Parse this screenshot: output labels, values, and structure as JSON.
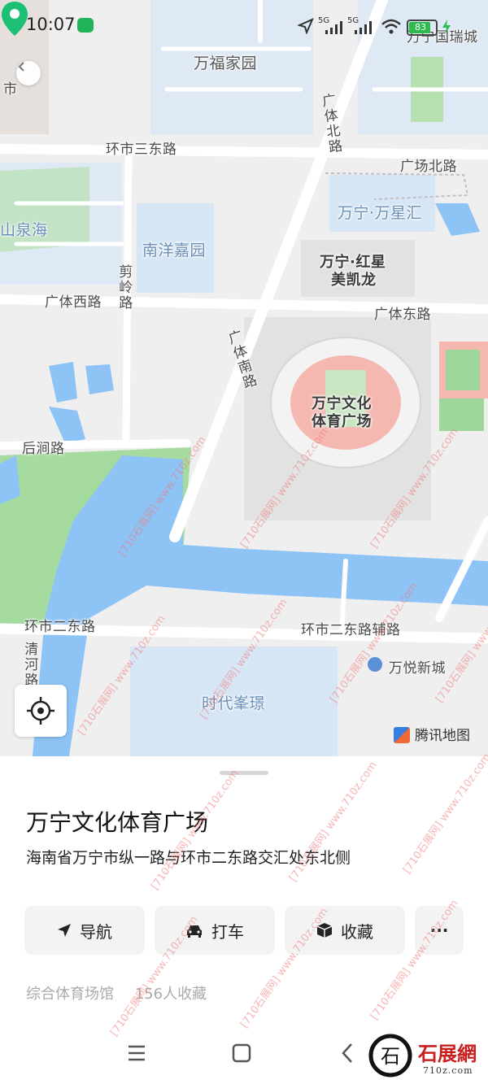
{
  "status_bar": {
    "time": "10:07",
    "network_1": "5G",
    "network_2": "5G",
    "battery": "83"
  },
  "map": {
    "labels": {
      "wanfu": "万福家园",
      "wanning_ruicheng": "万宁国瑞城",
      "market_short": "市",
      "huanshi_sandong": "环市三东路",
      "guangti_bei_road": "广体北路",
      "guangchang_bei": "广场北路",
      "wanning_wanxinghui": "万宁·万星汇",
      "shanquanhai": "山泉海",
      "nanyang": "南洋嘉园",
      "jianling": "剪岭路",
      "wanning_hongxing": "万宁·红星",
      "meikailong": "美凯龙",
      "guangti_xi": "广体西路",
      "guangti_dong": "广体东路",
      "guangti_nan": "广体南路",
      "stadium_line1": "万宁文化",
      "stadium_line2": "体育广场",
      "houjian": "后涧路",
      "huanshi_erdong": "环市二东路",
      "huanshi_erdong_fulu": "环市二东路辅路",
      "qinghe": "清河路",
      "wanyue": "万悦新城",
      "shidai": "时代峯璟"
    },
    "attribution": "腾讯地图",
    "colors": {
      "land": "#efefef",
      "building": "#e2e2e2",
      "water": "#8ec3f5",
      "park": "#a6dba0",
      "residential": "#d7e6f5",
      "pin": "#1dbf73"
    }
  },
  "sheet": {
    "title": "万宁文化体育广场",
    "address": "海南省万宁市纵一路与环市二东路交汇处东北侧",
    "actions": {
      "navigate": "导航",
      "taxi": "打车",
      "favorite": "收藏",
      "more": "···"
    },
    "category": "综合体育场馆",
    "favorites": "156人收藏"
  },
  "watermark": {
    "brand": "石展網",
    "domain": "710z.com",
    "logo_char": "石",
    "repeat_text": "[710石展网]  www.710z.com"
  }
}
